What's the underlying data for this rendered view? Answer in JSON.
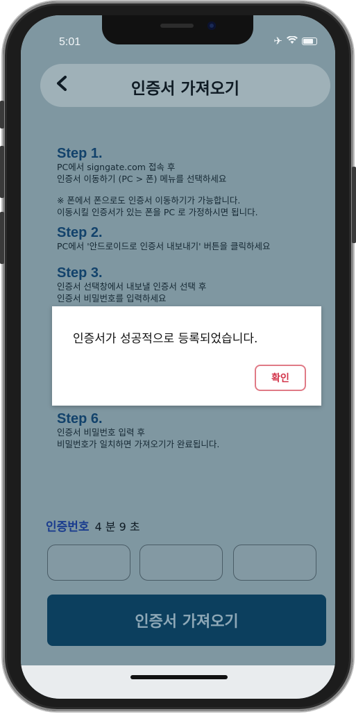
{
  "status_bar": {
    "time": "5:01",
    "icons": [
      "airplane-icon",
      "wifi-icon",
      "battery-icon"
    ]
  },
  "header": {
    "back_icon": "chevron-left-icon",
    "title": "인증서 가져오기"
  },
  "steps": [
    {
      "title": "Step 1.",
      "lines": [
        "PC에서 signgate.com 접속 후",
        "인증서 이동하기 (PC > 폰) 메뉴를 선택하세요"
      ],
      "note_lines": [
        "※ 폰에서 폰으로도 인증서 이동하기가 가능합니다.",
        "이동시킬 인증서가 있는 폰을 PC 로 가정하시면 됩니다."
      ]
    },
    {
      "title": "Step 2.",
      "lines": [
        "PC에서 '안드로이드로 인증서 내보내기' 버튼을 클릭하세요"
      ]
    },
    {
      "title": "Step 3.",
      "lines": [
        "인증서 선택창에서 내보낼 인증서 선택 후",
        "인증서 비밀번호를 입력하세요"
      ]
    },
    {
      "title": "Step 6.",
      "lines": [
        "인증서 비밀번호 입력 후",
        "비밀번호가 일치하면 가져오기가 완료됩니다."
      ]
    }
  ],
  "auth": {
    "label": "인증번호",
    "time_remaining": "4 분 9 초"
  },
  "code_inputs": [
    "",
    "",
    ""
  ],
  "import_button": "인증서 가져오기",
  "dialog": {
    "message": "인증서가 성공적으로 등록되었습니다.",
    "confirm": "확인"
  }
}
